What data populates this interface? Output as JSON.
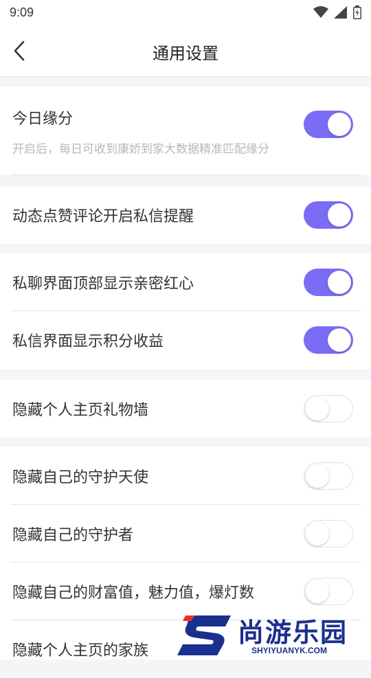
{
  "status": {
    "time": "9:09"
  },
  "header": {
    "title": "通用设置"
  },
  "settings": {
    "today_match": {
      "label": "今日缘分",
      "desc": "开启后，每日可收到康娇到家大数据精准匹配缘分",
      "enabled": true
    },
    "like_comment_dm": {
      "label": "动态点赞评论开启私信提醒",
      "enabled": true
    },
    "chat_top_heart": {
      "label": "私聊界面顶部显示亲密红心",
      "enabled": true
    },
    "dm_points": {
      "label": "私信界面显示积分收益",
      "enabled": true
    },
    "hide_gift_wall": {
      "label": "隐藏个人主页礼物墙",
      "enabled": false
    },
    "hide_guardian_angel": {
      "label": "隐藏自己的守护天使",
      "enabled": false
    },
    "hide_guardian": {
      "label": "隐藏自己的守护者",
      "enabled": false
    },
    "hide_wealth": {
      "label": "隐藏自己的财富值，魅力值，爆灯数",
      "enabled": false
    },
    "hide_family": {
      "label": "隐藏个人主页的家族",
      "enabled": false
    }
  },
  "colors": {
    "accent": "#7b6cf6",
    "background": "#f5f5f7"
  },
  "watermark": {
    "text": "尚游乐园",
    "sub": "SHYIYUANYK.COM"
  }
}
